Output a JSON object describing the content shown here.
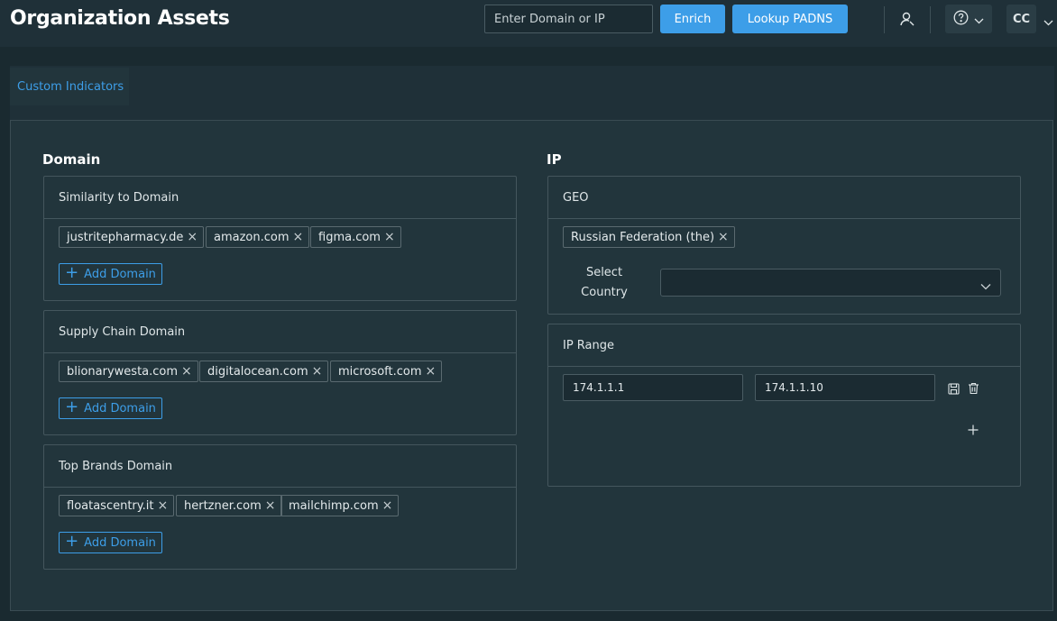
{
  "header": {
    "title": "Organization Assets",
    "search_placeholder": "Enter Domain or IP",
    "enrich_label": "Enrich",
    "lookup_label": "Lookup PADNS",
    "avatar_initials": "CC"
  },
  "tabs": [
    {
      "label": "Custom Indicators",
      "active": true
    }
  ],
  "domain": {
    "title": "Domain",
    "cards": [
      {
        "title": "Similarity to Domain",
        "tags": [
          "justritepharmacy.de",
          "amazon.com",
          "figma.com"
        ],
        "add_label": "Add Domain"
      },
      {
        "title": "Supply Chain Domain",
        "tags": [
          "blionarywesta.com",
          "digitalocean.com",
          "microsoft.com"
        ],
        "add_label": "Add Domain"
      },
      {
        "title": "Top Brands Domain",
        "tags": [
          "floatascentry.it",
          "hertzner.com",
          "mailchimp.com"
        ],
        "add_label": "Add Domain"
      }
    ]
  },
  "ip": {
    "title": "IP",
    "geo": {
      "title": "GEO",
      "tags": [
        "Russian Federation (the)"
      ],
      "select_label_line1": "Select",
      "select_label_line2": "Country",
      "select_value": ""
    },
    "ip_range": {
      "title": "IP Range",
      "start": "174.1.1.1",
      "end": "174.1.1.10"
    }
  },
  "colors": {
    "accent": "#3d9ee8",
    "background": "#1a2a30",
    "panel": "#22353c"
  }
}
